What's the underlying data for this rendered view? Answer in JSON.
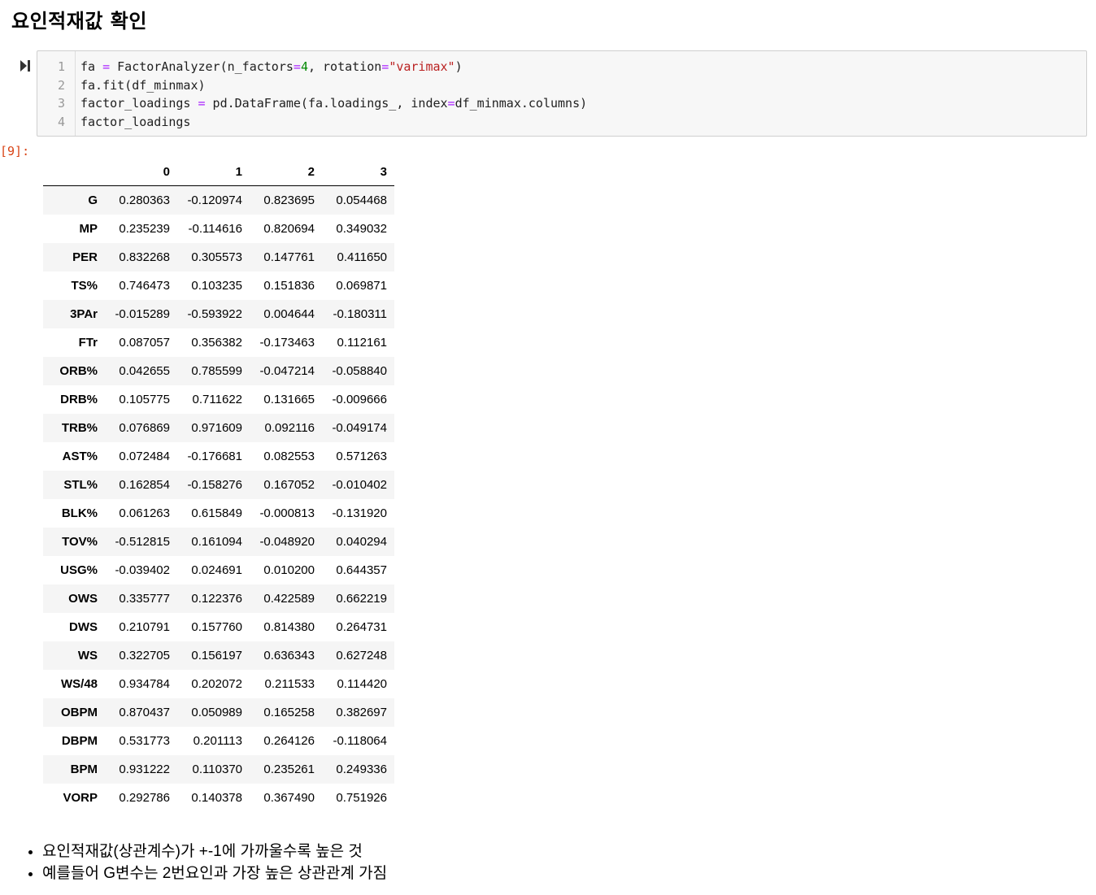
{
  "heading": "요인적재값 확인",
  "cell": {
    "lines": [
      {
        "num": "1",
        "tokens": [
          {
            "t": "fa ",
            "c": ""
          },
          {
            "t": "=",
            "c": "op"
          },
          {
            "t": " FactorAnalyzer(n_factors",
            "c": ""
          },
          {
            "t": "=",
            "c": "op"
          },
          {
            "t": "4",
            "c": "num"
          },
          {
            "t": ", rotation",
            "c": ""
          },
          {
            "t": "=",
            "c": "op"
          },
          {
            "t": "\"varimax\"",
            "c": "str"
          },
          {
            "t": ")",
            "c": ""
          }
        ]
      },
      {
        "num": "2",
        "tokens": [
          {
            "t": "fa.fit(df_minmax)",
            "c": ""
          }
        ]
      },
      {
        "num": "3",
        "tokens": [
          {
            "t": "factor_loadings ",
            "c": ""
          },
          {
            "t": "=",
            "c": "op"
          },
          {
            "t": " pd.DataFrame(fa.loadings_, index",
            "c": ""
          },
          {
            "t": "=",
            "c": "op"
          },
          {
            "t": "df_minmax.columns)",
            "c": ""
          }
        ]
      },
      {
        "num": "4",
        "tokens": [
          {
            "t": "factor_loadings",
            "c": ""
          }
        ]
      }
    ]
  },
  "output_prompt": "[9]:",
  "table": {
    "columns": [
      "0",
      "1",
      "2",
      "3"
    ],
    "rows": [
      {
        "index": "G",
        "values": [
          "0.280363",
          "-0.120974",
          "0.823695",
          "0.054468"
        ]
      },
      {
        "index": "MP",
        "values": [
          "0.235239",
          "-0.114616",
          "0.820694",
          "0.349032"
        ]
      },
      {
        "index": "PER",
        "values": [
          "0.832268",
          "0.305573",
          "0.147761",
          "0.411650"
        ]
      },
      {
        "index": "TS%",
        "values": [
          "0.746473",
          "0.103235",
          "0.151836",
          "0.069871"
        ]
      },
      {
        "index": "3PAr",
        "values": [
          "-0.015289",
          "-0.593922",
          "0.004644",
          "-0.180311"
        ]
      },
      {
        "index": "FTr",
        "values": [
          "0.087057",
          "0.356382",
          "-0.173463",
          "0.112161"
        ]
      },
      {
        "index": "ORB%",
        "values": [
          "0.042655",
          "0.785599",
          "-0.047214",
          "-0.058840"
        ]
      },
      {
        "index": "DRB%",
        "values": [
          "0.105775",
          "0.711622",
          "0.131665",
          "-0.009666"
        ]
      },
      {
        "index": "TRB%",
        "values": [
          "0.076869",
          "0.971609",
          "0.092116",
          "-0.049174"
        ]
      },
      {
        "index": "AST%",
        "values": [
          "0.072484",
          "-0.176681",
          "0.082553",
          "0.571263"
        ]
      },
      {
        "index": "STL%",
        "values": [
          "0.162854",
          "-0.158276",
          "0.167052",
          "-0.010402"
        ]
      },
      {
        "index": "BLK%",
        "values": [
          "0.061263",
          "0.615849",
          "-0.000813",
          "-0.131920"
        ]
      },
      {
        "index": "TOV%",
        "values": [
          "-0.512815",
          "0.161094",
          "-0.048920",
          "0.040294"
        ]
      },
      {
        "index": "USG%",
        "values": [
          "-0.039402",
          "0.024691",
          "0.010200",
          "0.644357"
        ]
      },
      {
        "index": "OWS",
        "values": [
          "0.335777",
          "0.122376",
          "0.422589",
          "0.662219"
        ]
      },
      {
        "index": "DWS",
        "values": [
          "0.210791",
          "0.157760",
          "0.814380",
          "0.264731"
        ]
      },
      {
        "index": "WS",
        "values": [
          "0.322705",
          "0.156197",
          "0.636343",
          "0.627248"
        ]
      },
      {
        "index": "WS/48",
        "values": [
          "0.934784",
          "0.202072",
          "0.211533",
          "0.114420"
        ]
      },
      {
        "index": "OBPM",
        "values": [
          "0.870437",
          "0.050989",
          "0.165258",
          "0.382697"
        ]
      },
      {
        "index": "DBPM",
        "values": [
          "0.531773",
          "0.201113",
          "0.264126",
          "-0.118064"
        ]
      },
      {
        "index": "BPM",
        "values": [
          "0.931222",
          "0.110370",
          "0.235261",
          "0.249336"
        ]
      },
      {
        "index": "VORP",
        "values": [
          "0.292786",
          "0.140378",
          "0.367490",
          "0.751926"
        ]
      }
    ]
  },
  "notes": [
    "요인적재값(상관계수)가 +-1에 가까울수록 높은 것",
    "예를들어 G변수는 2번요인과 가장 높은 상관관계 가짐"
  ],
  "icons": {
    "run": "run-cell-icon"
  }
}
